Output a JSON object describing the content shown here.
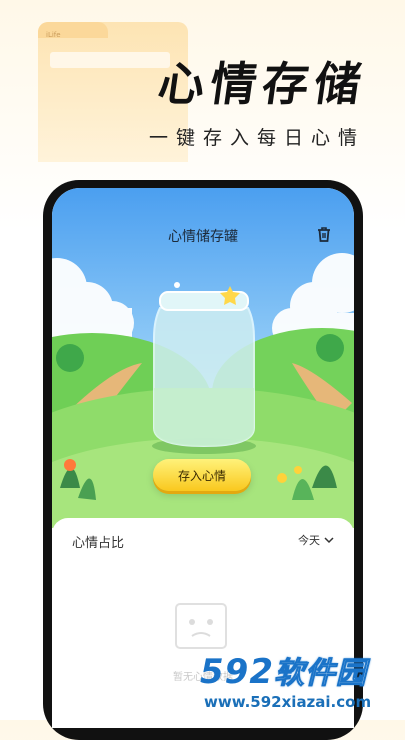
{
  "promo": {
    "folder_label": "iLife",
    "headline": "心情存储",
    "subline": "一键存入每日心情"
  },
  "app": {
    "title": "心情储存罐",
    "save_button": "存入心情",
    "panel_title": "心情占比",
    "range_selected": "今天",
    "empty_text": "暂无心情数据"
  },
  "watermark": {
    "brand_number": "592",
    "brand_text": "软件园",
    "url": "www.592xiazai.com"
  },
  "colors": {
    "button_yellow": "#f9c81e",
    "sky_blue": "#4b9ff0",
    "grass_green": "#5cc24a",
    "watermark_blue": "#1a73c8"
  }
}
